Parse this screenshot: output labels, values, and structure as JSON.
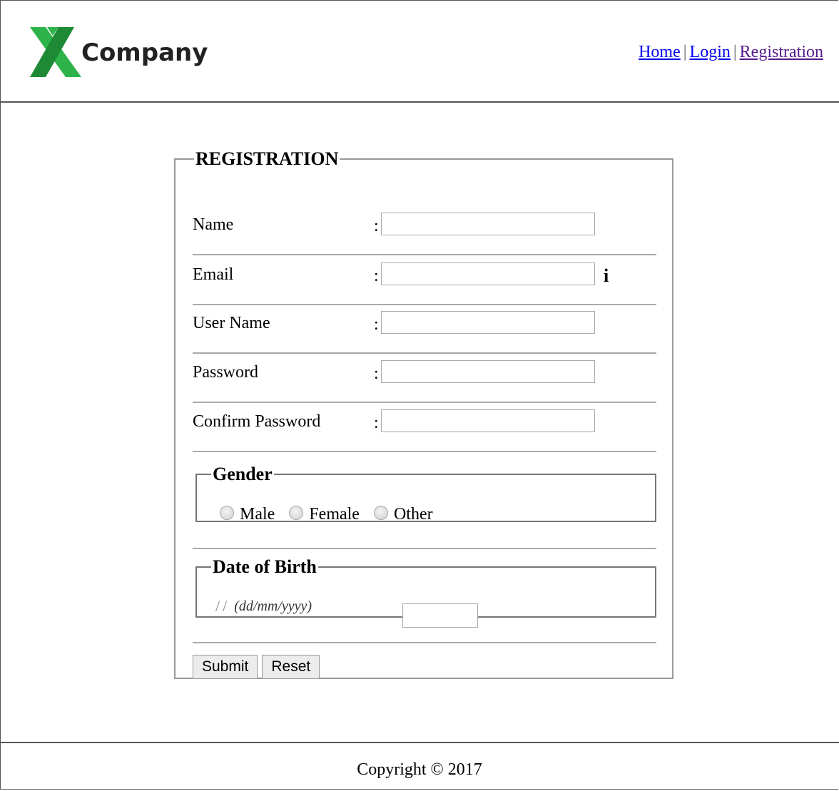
{
  "header": {
    "logo_text": "Company",
    "nav": {
      "home": "Home",
      "login": "Login",
      "registration": "Registration",
      "separator": "|"
    }
  },
  "form": {
    "legend": "REGISTRATION",
    "colon": ":",
    "fields": [
      {
        "label": "Name",
        "value": ""
      },
      {
        "label": "Email",
        "value": "",
        "info": "i"
      },
      {
        "label": "User Name",
        "value": ""
      },
      {
        "label": "Password",
        "value": ""
      },
      {
        "label": "Confirm Password",
        "value": ""
      }
    ],
    "gender": {
      "legend": "Gender",
      "options": [
        "Male",
        "Female",
        "Other"
      ]
    },
    "dob": {
      "legend": "Date of Birth",
      "separator": "/",
      "hint": "(dd/mm/yyyy)"
    },
    "buttons": {
      "submit": "Submit",
      "reset": "Reset"
    }
  },
  "footer": {
    "copyright": "Copyright © 2017"
  },
  "colors": {
    "logo_green": "#2db34a",
    "link": "#0000ee",
    "visited_link": "#551a8b"
  }
}
